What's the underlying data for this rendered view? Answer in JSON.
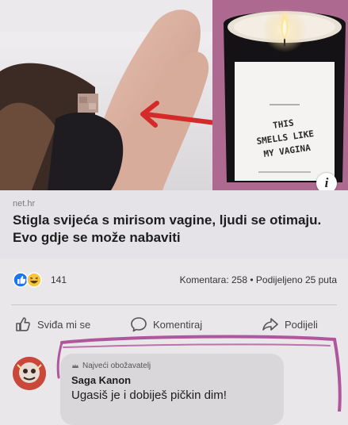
{
  "post": {
    "image": {
      "candle_label": [
        "THIS",
        "SMELLS LIKE",
        "MY VAGINA"
      ],
      "info_icon": "info-icon",
      "arrow_color": "#d42a2a"
    },
    "link": {
      "source": "net.hr",
      "headline": "Stigla svijeća s mirisom vagine, ljudi se otimaju. Evo gdje se može nabaviti"
    },
    "stats": {
      "reaction_icons": [
        "like-icon",
        "laugh-icon"
      ],
      "reaction_count": "141",
      "comments": "Komentara: 258",
      "separator": "•",
      "shares": "Podijeljeno 25 puta"
    },
    "actions": {
      "like": "Sviđa mi se",
      "comment": "Komentiraj",
      "share": "Podijeli"
    },
    "comment": {
      "badge": "Najveći obožavatelj",
      "author": "Saga Kanon",
      "text": "Ugasiš je i dobiješ pičkin dim!"
    },
    "colors": {
      "like_blue": "#1877f2",
      "laugh_yellow": "#f7c53e",
      "highlight_purple": "#b0569c"
    }
  }
}
